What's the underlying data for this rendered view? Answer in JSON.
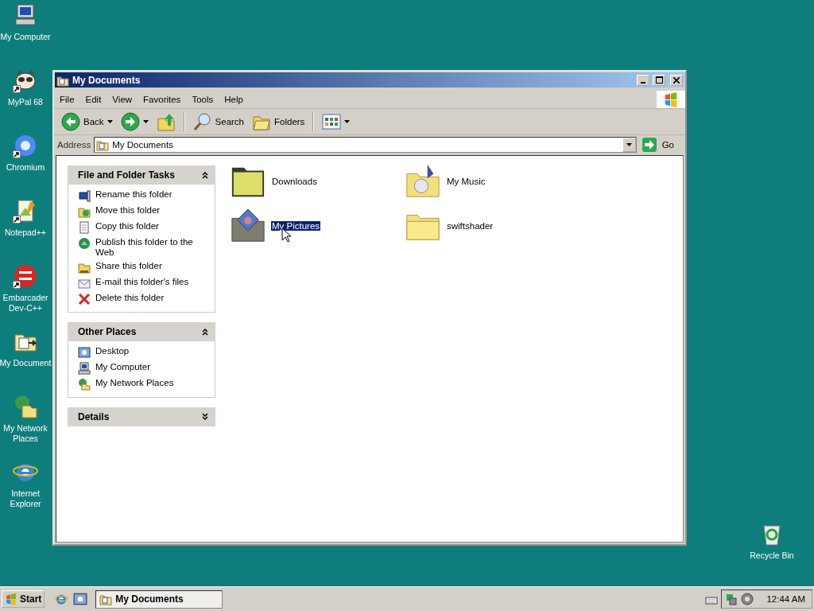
{
  "desktop_icons": [
    {
      "label": "My Computer",
      "kind": "computer",
      "shortcut": false
    },
    {
      "label": "MyPal 68",
      "kind": "raccoon",
      "shortcut": true
    },
    {
      "label": "Chromium",
      "kind": "browser",
      "shortcut": true
    },
    {
      "label": "Notepad++",
      "kind": "notepad",
      "shortcut": true
    },
    {
      "label": "Embarcader\nDev-C++",
      "kind": "devcpp",
      "shortcut": true
    },
    {
      "label": "My Document",
      "kind": "documents",
      "shortcut": false
    },
    {
      "label": "My Network\nPlaces",
      "kind": "network",
      "shortcut": false
    },
    {
      "label": "Internet\nExplorer",
      "kind": "ie",
      "shortcut": false
    }
  ],
  "recycle_bin": {
    "label": "Recycle Bin"
  },
  "window": {
    "title": "My Documents",
    "menu": [
      "File",
      "Edit",
      "View",
      "Favorites",
      "Tools",
      "Help"
    ],
    "toolbar": {
      "back": "Back",
      "search": "Search",
      "folders": "Folders"
    },
    "address": {
      "label": "Address",
      "value": "My Documents",
      "go": "Go"
    },
    "task_panes": [
      {
        "title": "File and Folder Tasks",
        "expanded": true,
        "items": [
          {
            "label": "Rename this folder",
            "kind": "rename"
          },
          {
            "label": "Move this folder",
            "kind": "move"
          },
          {
            "label": "Copy this folder",
            "kind": "copy"
          },
          {
            "label": "Publish this folder to the Web",
            "kind": "publish"
          },
          {
            "label": "Share this folder",
            "kind": "share"
          },
          {
            "label": "E-mail this folder's files",
            "kind": "email"
          },
          {
            "label": "Delete this folder",
            "kind": "delete"
          }
        ]
      },
      {
        "title": "Other Places",
        "expanded": true,
        "items": [
          {
            "label": "Desktop",
            "kind": "desktop"
          },
          {
            "label": "My Computer",
            "kind": "computer"
          },
          {
            "label": "My Network Places",
            "kind": "network"
          }
        ]
      },
      {
        "title": "Details",
        "expanded": false
      }
    ],
    "files": [
      {
        "label": "Downloads",
        "kind": "folder-dark",
        "selected": false
      },
      {
        "label": "My Music",
        "kind": "music",
        "selected": false
      },
      {
        "label": "My Pictures",
        "kind": "pictures",
        "selected": true
      },
      {
        "label": "swiftshader",
        "kind": "folder",
        "selected": false
      }
    ]
  },
  "taskbar": {
    "start": "Start",
    "tasks": [
      {
        "label": "My Documents",
        "selected": true
      }
    ],
    "clock": "12:44 AM"
  }
}
